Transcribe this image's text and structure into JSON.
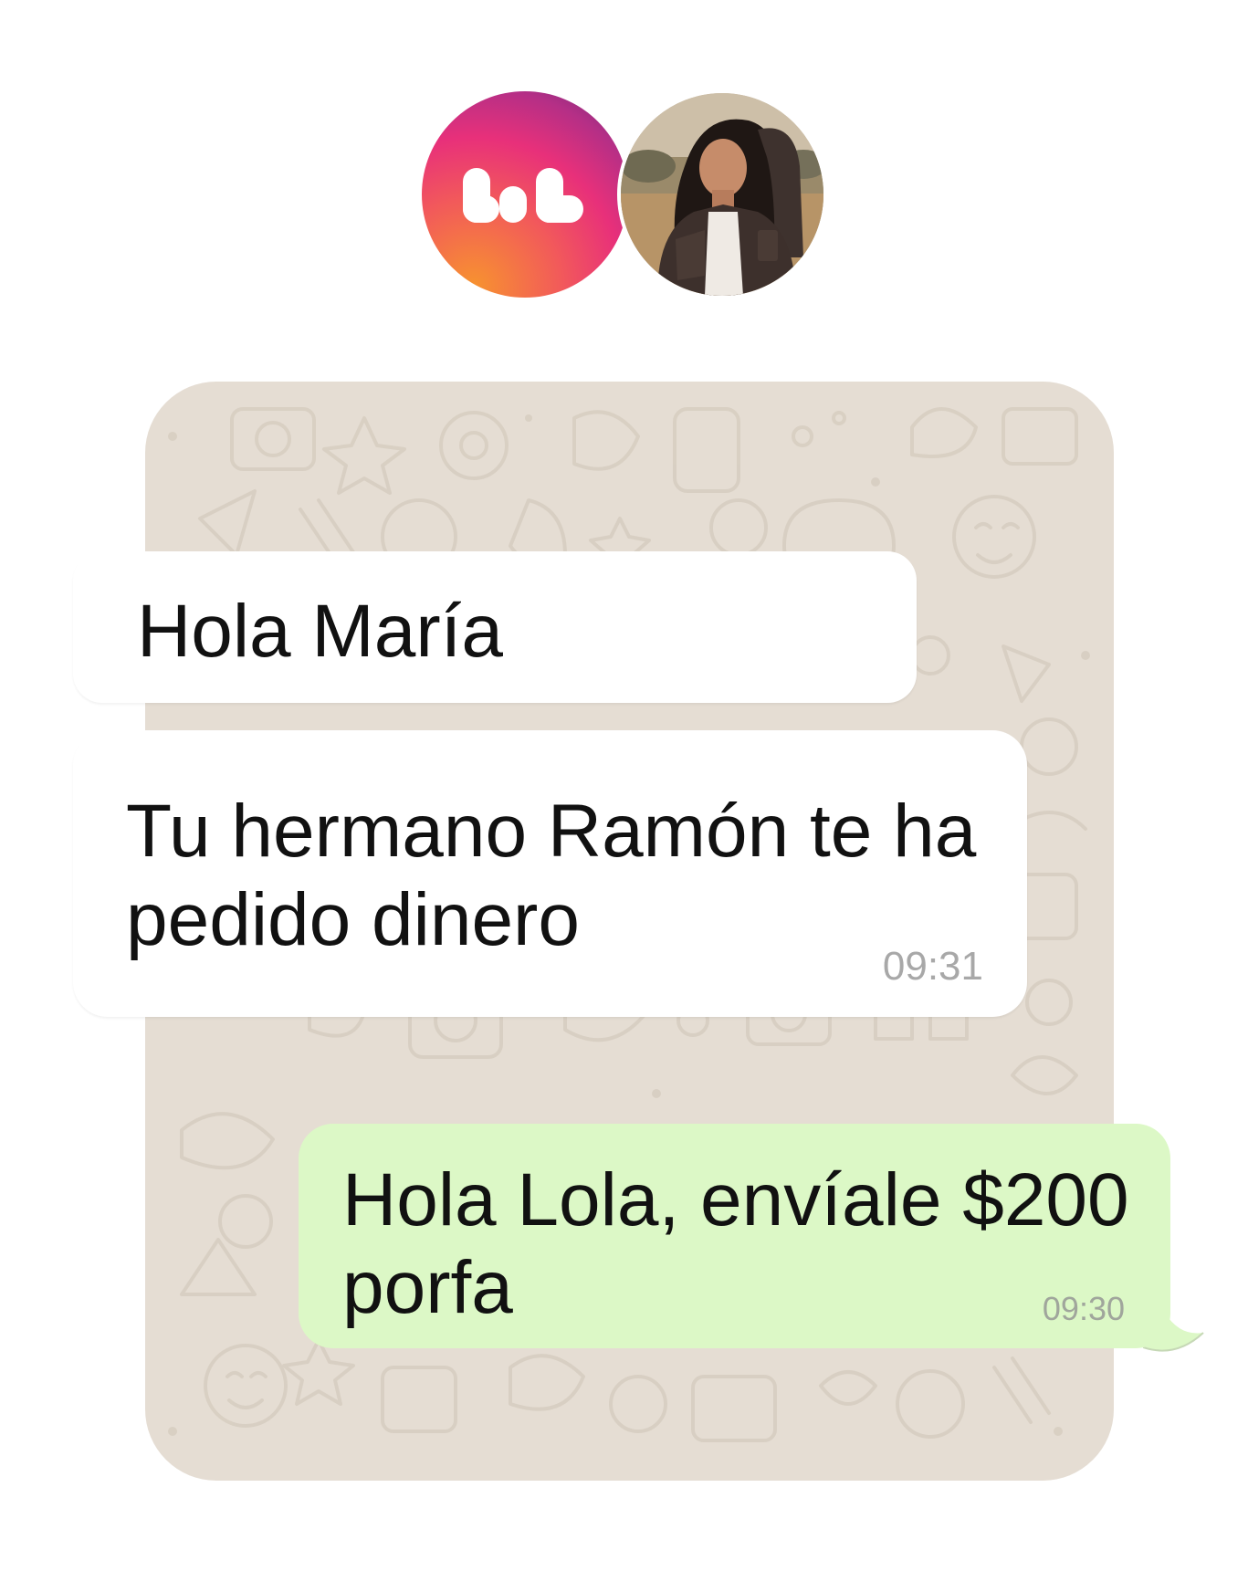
{
  "avatars": {
    "brand": {
      "icon": "bars-logo-icon",
      "colors": [
        "#f7932f",
        "#e8307a",
        "#6a2a78"
      ]
    },
    "contact": {
      "icon": "person-photo"
    }
  },
  "messages": [
    {
      "direction": "incoming",
      "text": "Hola María",
      "time": ""
    },
    {
      "direction": "incoming",
      "text": "Tu hermano Ramón te ha pedido dinero",
      "time": "09:31"
    },
    {
      "direction": "outgoing",
      "text": "Hola Lola, envíale $200 porfa",
      "time": "09:30"
    }
  ],
  "colors": {
    "chat_background": "#e5ddd3",
    "incoming_bubble": "#ffffff",
    "outgoing_bubble": "#dcf8c6"
  }
}
